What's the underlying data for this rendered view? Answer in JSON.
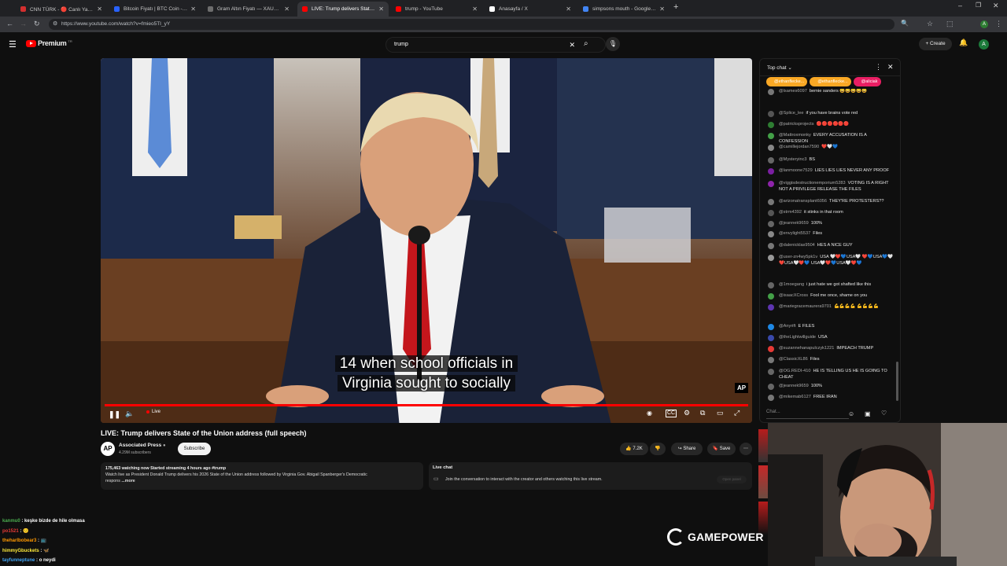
{
  "browser": {
    "tabs": [
      {
        "label": "CNN TÜRK - 🔴 Canlı Yayın ᴴᴰ",
        "color": "#d32f2f",
        "active": false
      },
      {
        "label": "Bitcoin Fiyatı | BTC Coin - Invest",
        "color": "#2962ff",
        "active": false
      },
      {
        "label": "Gram Altın Fiyatı — XAUTRYG",
        "color": "#6d6d6d",
        "active": false
      },
      {
        "label": "LIVE: Trump delivers State o",
        "color": "#ff0000",
        "active": true
      },
      {
        "label": "trump - YouTube",
        "color": "#ff0000",
        "active": false
      },
      {
        "label": "Anasayfa / X",
        "color": "#ffffff",
        "active": false
      },
      {
        "label": "simpsons mouth - Google Sear",
        "color": "#4285f4",
        "active": false
      }
    ],
    "new_tab": "+",
    "url": "https://www.youtube.com/watch?v=fmieo5TI_yY"
  },
  "youtube": {
    "logo": "Premium",
    "logo_suffix": "TR",
    "search_value": "trump",
    "create_label": "Create",
    "avatar_letter": "A"
  },
  "player": {
    "subtitle_line1": "14 when school officials in",
    "subtitle_line2": "Virginia sought to socially",
    "live_label": "Live",
    "watermark": "AP",
    "progress": 1.0
  },
  "video": {
    "title": "LIVE: Trump delivers State of the Union address (full speech)",
    "channel": "Associated Press",
    "channel_logo": "AP",
    "subscribers": "4.29M subscribers",
    "subscribe_label": "Subscribe",
    "likes": "7.2K",
    "share_label": "Share",
    "save_label": "Save",
    "description_meta": "175,463 watching now  Started streaming 4 hours ago  #trump",
    "description_line1": "Watch live as President Donald Trump delivers his 2026 State of the Union address followed by Virginia Gov. Abigail Spanberger's Democratic",
    "description_line2": "respons",
    "description_more": "...more",
    "livechat_title": "Live chat",
    "livechat_text": "Join the conversation to interact with the creator and others watching this live stream.",
    "livechat_button": "Open panel"
  },
  "chat": {
    "header": "Top chat",
    "pinned": [
      "@ethanflecke...",
      "@ethanflecke...",
      "@aliciak"
    ],
    "input_placeholder": "Chat...",
    "messages": [
      {
        "author": "@lsames6097",
        "text": "bernie sanders 😄😄😄😄😄",
        "color": "#777"
      },
      {
        "author": "@Splice_lee",
        "text": "if you have brains vote red",
        "color": "#555"
      },
      {
        "author": "@patricksprojects",
        "text": "🔴🔴🔴🔴🔴🔴",
        "color": "#2e7d32"
      },
      {
        "author": "@Mattroxmonky",
        "text": "EVERY ACCUSATION IS A CONFESSION",
        "color": "#43a047"
      },
      {
        "author": "@camillejordan7590",
        "text": "❤️🤍💙",
        "color": "#888"
      },
      {
        "author": "@Mysteryinc3",
        "text": "BS",
        "color": "#666"
      },
      {
        "author": "@lanmoone7529",
        "text": "LIES LIES LIES NEVER ANY PROOF",
        "color": "#7b1fa2"
      },
      {
        "author": "@viggisdestructionemporium5283",
        "text": "VOTING IS A RIGHT NOT A PRIVILEGE RELEASE THE FILES",
        "color": "#8e24aa"
      },
      {
        "author": "@arizonatransplant6056",
        "text": "THEY'RE PROTESTERS??",
        "color": "#777"
      },
      {
        "author": "@strm4392",
        "text": "it stinks in that room",
        "color": "#555"
      },
      {
        "author": "@jeannek9659",
        "text": "100%",
        "color": "#666"
      },
      {
        "author": "@envylight5537",
        "text": "Files",
        "color": "#888"
      },
      {
        "author": "@dalenicklas9504",
        "text": "HES A NICE GUY",
        "color": "#777"
      },
      {
        "author": "@user-zn4wy5pk1v",
        "text": "USA 🤍❤️💙USA🤍 ❤️💙USA💙🤍❤️USA🤍❤️💙 USA🤍❤️💙USA🤍❤️💙",
        "color": "#999"
      },
      {
        "author": "@1moegang",
        "text": "i just hate we got shafted like this",
        "color": "#666"
      },
      {
        "author": "@isaacXCross",
        "text": "Fool me once, shame on you",
        "color": "#43a047"
      },
      {
        "author": "@mariegracemaurera9701",
        "text": "💪💪💪💪 💪💪💪💪",
        "color": "#5e35b1"
      },
      {
        "author": "@Anyrift",
        "text": "E FILES",
        "color": "#1e88e5"
      },
      {
        "author": "@theLightwillguide",
        "text": "USA",
        "color": "#3949ab"
      },
      {
        "author": "@suzannehanapulczyk1221",
        "text": "IMPEACH TRUMP",
        "color": "#e53935"
      },
      {
        "author": "@ClassicXL86",
        "text": "Files",
        "color": "#777"
      },
      {
        "author": "@OG.REDI-410",
        "text": "HE IS TELLING US HE IS GOING TO CHEAT",
        "color": "#666"
      },
      {
        "author": "@jeannek9659",
        "text": "100%",
        "color": "#666"
      },
      {
        "author": "@mikemab6127",
        "text": "FREE IRAN",
        "color": "#777"
      }
    ]
  },
  "stream_overlay": {
    "lines": [
      {
        "user": "kanmu0",
        "text": "keşke bizde de hile olmasa",
        "color": "#4caf50"
      },
      {
        "user": "po1521",
        "text": "🙂",
        "color": "#e53935"
      },
      {
        "user": "theharlbobear3",
        "text": "📺",
        "color": "#ff9800"
      },
      {
        "user": "himmyGbuckets",
        "text": "🦋",
        "color": "#ffeb3b"
      },
      {
        "user": "tayfunneptune",
        "text": "o neydi",
        "color": "#42a5f5"
      }
    ],
    "brand": "GAMEPOWER"
  }
}
